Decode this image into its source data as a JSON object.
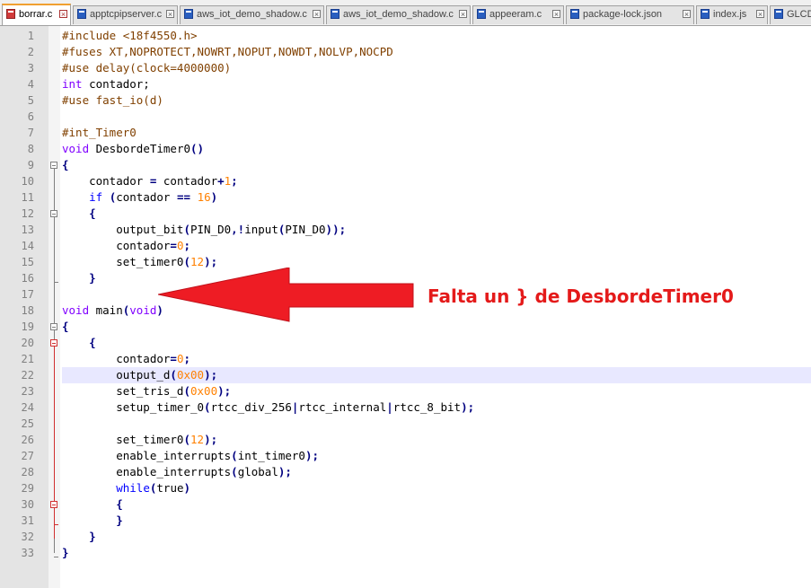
{
  "tabs": [
    {
      "label": "borrar.c",
      "active": true
    },
    {
      "label": "apptcpipserver.c",
      "active": false
    },
    {
      "label": "aws_iot_demo_shadow.c",
      "active": false
    },
    {
      "label": "aws_iot_demo_shadow.c",
      "active": false
    },
    {
      "label": "appeeram.c",
      "active": false
    },
    {
      "label": "package-lock.json",
      "active": false
    },
    {
      "label": "index.js",
      "active": false
    },
    {
      "label": "GLCD.c",
      "active": false
    }
  ],
  "editor": {
    "highlighted_line": 22,
    "lines": [
      {
        "n": "1",
        "tokens": [
          [
            "pre",
            "#include <18f4550.h>"
          ]
        ]
      },
      {
        "n": "2",
        "tokens": [
          [
            "pre",
            "#fuses XT,NOPROTECT,NOWRT,NOPUT,NOWDT,NOLVP,NOCPD"
          ]
        ]
      },
      {
        "n": "3",
        "tokens": [
          [
            "pre",
            "#use delay(clock=4000000)"
          ]
        ]
      },
      {
        "n": "4",
        "tokens": [
          [
            "type",
            "int"
          ],
          [
            "def",
            " contador;"
          ]
        ]
      },
      {
        "n": "5",
        "tokens": [
          [
            "pre",
            "#use fast_io(d)"
          ]
        ]
      },
      {
        "n": "6",
        "tokens": []
      },
      {
        "n": "7",
        "tokens": [
          [
            "pre",
            "#int_Timer0"
          ]
        ]
      },
      {
        "n": "8",
        "tokens": [
          [
            "type",
            "void"
          ],
          [
            "def",
            " DesbordeTimer0"
          ],
          [
            "op",
            "()"
          ]
        ]
      },
      {
        "n": "9",
        "tokens": [
          [
            "op",
            "{"
          ]
        ]
      },
      {
        "n": "10",
        "tokens": [
          [
            "def",
            "    contador "
          ],
          [
            "op",
            "="
          ],
          [
            "def",
            " contador"
          ],
          [
            "op",
            "+"
          ],
          [
            "num",
            "1"
          ],
          [
            "op",
            ";"
          ]
        ]
      },
      {
        "n": "11",
        "tokens": [
          [
            "def",
            "    "
          ],
          [
            "kw",
            "if"
          ],
          [
            "def",
            " "
          ],
          [
            "op",
            "("
          ],
          [
            "def",
            "contador "
          ],
          [
            "op",
            "=="
          ],
          [
            "def",
            " "
          ],
          [
            "num",
            "16"
          ],
          [
            "op",
            ")"
          ]
        ]
      },
      {
        "n": "12",
        "tokens": [
          [
            "def",
            "    "
          ],
          [
            "op",
            "{"
          ]
        ]
      },
      {
        "n": "13",
        "tokens": [
          [
            "def",
            "        output_bit"
          ],
          [
            "op",
            "("
          ],
          [
            "def",
            "PIN_D0"
          ],
          [
            "op",
            ",!"
          ],
          [
            "def",
            "input"
          ],
          [
            "op",
            "("
          ],
          [
            "def",
            "PIN_D0"
          ],
          [
            "op",
            "));"
          ]
        ]
      },
      {
        "n": "14",
        "tokens": [
          [
            "def",
            "        contador"
          ],
          [
            "op",
            "="
          ],
          [
            "num",
            "0"
          ],
          [
            "op",
            ";"
          ]
        ]
      },
      {
        "n": "15",
        "tokens": [
          [
            "def",
            "        set_timer0"
          ],
          [
            "op",
            "("
          ],
          [
            "num",
            "12"
          ],
          [
            "op",
            ");"
          ]
        ]
      },
      {
        "n": "16",
        "tokens": [
          [
            "def",
            "    "
          ],
          [
            "op",
            "}"
          ]
        ]
      },
      {
        "n": "17",
        "tokens": []
      },
      {
        "n": "18",
        "tokens": [
          [
            "type",
            "void"
          ],
          [
            "def",
            " main"
          ],
          [
            "op",
            "("
          ],
          [
            "type",
            "void"
          ],
          [
            "op",
            ")"
          ]
        ]
      },
      {
        "n": "19",
        "tokens": [
          [
            "op",
            "{"
          ]
        ]
      },
      {
        "n": "20",
        "tokens": [
          [
            "def",
            "    "
          ],
          [
            "op",
            "{"
          ]
        ]
      },
      {
        "n": "21",
        "tokens": [
          [
            "def",
            "        contador"
          ],
          [
            "op",
            "="
          ],
          [
            "num",
            "0"
          ],
          [
            "op",
            ";"
          ]
        ]
      },
      {
        "n": "22",
        "tokens": [
          [
            "def",
            "        output_d"
          ],
          [
            "op",
            "("
          ],
          [
            "num",
            "0x00"
          ],
          [
            "op",
            ");"
          ]
        ]
      },
      {
        "n": "23",
        "tokens": [
          [
            "def",
            "        set_tris_d"
          ],
          [
            "op",
            "("
          ],
          [
            "num",
            "0x00"
          ],
          [
            "op",
            ");"
          ]
        ]
      },
      {
        "n": "24",
        "tokens": [
          [
            "def",
            "        setup_timer_0"
          ],
          [
            "op",
            "("
          ],
          [
            "def",
            "rtcc_div_256"
          ],
          [
            "op",
            "|"
          ],
          [
            "def",
            "rtcc_internal"
          ],
          [
            "op",
            "|"
          ],
          [
            "def",
            "rtcc_8_bit"
          ],
          [
            "op",
            ");"
          ]
        ]
      },
      {
        "n": "25",
        "tokens": []
      },
      {
        "n": "26",
        "tokens": [
          [
            "def",
            "        set_timer0"
          ],
          [
            "op",
            "("
          ],
          [
            "num",
            "12"
          ],
          [
            "op",
            ");"
          ]
        ]
      },
      {
        "n": "27",
        "tokens": [
          [
            "def",
            "        enable_interrupts"
          ],
          [
            "op",
            "("
          ],
          [
            "def",
            "int_timer0"
          ],
          [
            "op",
            ");"
          ]
        ]
      },
      {
        "n": "28",
        "tokens": [
          [
            "def",
            "        enable_interrupts"
          ],
          [
            "op",
            "("
          ],
          [
            "def",
            "global"
          ],
          [
            "op",
            ");"
          ]
        ]
      },
      {
        "n": "29",
        "tokens": [
          [
            "def",
            "        "
          ],
          [
            "kw",
            "while"
          ],
          [
            "op",
            "("
          ],
          [
            "def",
            "true"
          ],
          [
            "op",
            ")"
          ]
        ]
      },
      {
        "n": "30",
        "tokens": [
          [
            "def",
            "        "
          ],
          [
            "op",
            "{"
          ]
        ]
      },
      {
        "n": "31",
        "tokens": [
          [
            "def",
            "        "
          ],
          [
            "op",
            "}"
          ]
        ]
      },
      {
        "n": "32",
        "tokens": [
          [
            "def",
            "    "
          ],
          [
            "op",
            "}"
          ]
        ]
      },
      {
        "n": "33",
        "tokens": [
          [
            "op",
            "}"
          ]
        ]
      }
    ]
  },
  "annotation": {
    "text": "Falta un } de DesbordeTimer0",
    "color": "#e41a1a"
  },
  "colors": {
    "active_tab_accent": "#f0a030",
    "preprocessor": "#804000",
    "keyword": "#0000ff",
    "type": "#8000ff",
    "number": "#ff8000",
    "operator": "#000080",
    "current_line": "#e8e8ff",
    "fold_error": "#d03030"
  }
}
